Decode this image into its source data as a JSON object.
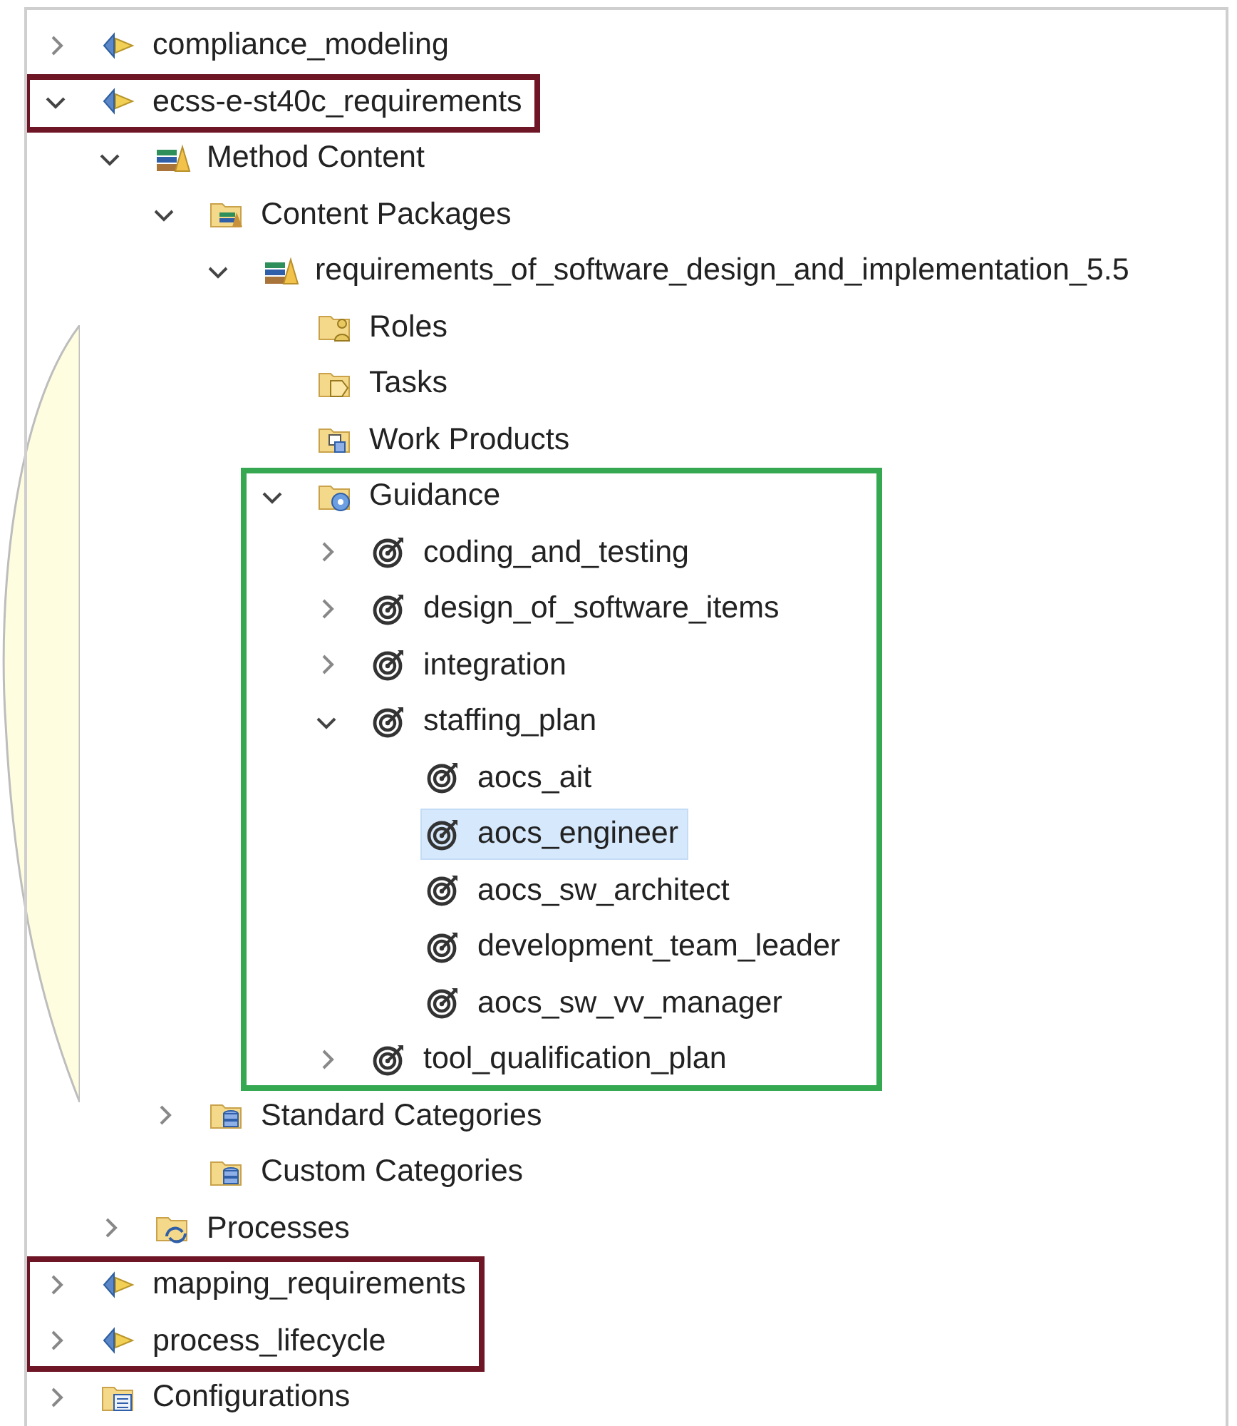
{
  "tree": [
    {
      "label": "compliance_modeling",
      "kind": "plugin",
      "expanded": false,
      "selected": false
    },
    {
      "label": "ecss-e-st40c_requirements",
      "kind": "plugin",
      "expanded": true,
      "selected": false,
      "frame": {
        "color": "#6e1626",
        "subtree": false
      },
      "children": [
        {
          "label": "Method Content",
          "kind": "method-content",
          "expanded": true,
          "selected": false,
          "children": [
            {
              "label": "Content Packages",
              "kind": "package-folder",
              "expanded": true,
              "selected": false,
              "children": [
                {
                  "label": "requirements_of_software_design_and_implementation_5.5",
                  "kind": "package",
                  "expanded": true,
                  "selected": false,
                  "children": [
                    {
                      "label": "Roles",
                      "kind": "roles",
                      "selected": false
                    },
                    {
                      "label": "Tasks",
                      "kind": "tasks",
                      "selected": false
                    },
                    {
                      "label": "Work Products",
                      "kind": "work-products",
                      "selected": false
                    },
                    {
                      "label": "Guidance",
                      "kind": "guidance",
                      "expanded": true,
                      "selected": false,
                      "frame": {
                        "color": "#36a852",
                        "subtree": true
                      },
                      "children": [
                        {
                          "label": "coding_and_testing",
                          "kind": "guideline",
                          "expanded": false,
                          "selected": false
                        },
                        {
                          "label": "design_of_software_items",
                          "kind": "guideline",
                          "expanded": false,
                          "selected": false
                        },
                        {
                          "label": "integration",
                          "kind": "guideline",
                          "expanded": false,
                          "selected": false
                        },
                        {
                          "label": "staffing_plan",
                          "kind": "guideline",
                          "expanded": true,
                          "selected": false,
                          "children": [
                            {
                              "label": "aocs_ait",
                              "kind": "guideline",
                              "selected": false
                            },
                            {
                              "label": "aocs_engineer",
                              "kind": "guideline",
                              "selected": true
                            },
                            {
                              "label": "aocs_sw_architect",
                              "kind": "guideline",
                              "selected": false
                            },
                            {
                              "label": "development_team_leader",
                              "kind": "guideline",
                              "selected": false
                            },
                            {
                              "label": "aocs_sw_vv_manager",
                              "kind": "guideline",
                              "selected": false
                            }
                          ]
                        },
                        {
                          "label": "tool_qualification_plan",
                          "kind": "guideline",
                          "expanded": false,
                          "selected": false
                        }
                      ]
                    }
                  ]
                }
              ]
            },
            {
              "label": "Standard Categories",
              "kind": "categories",
              "expanded": false,
              "selected": false
            },
            {
              "label": "Custom Categories",
              "kind": "categories",
              "selected": false
            }
          ]
        },
        {
          "label": "Processes",
          "kind": "processes",
          "expanded": false,
          "selected": false
        }
      ]
    },
    {
      "label": "mapping_requirements",
      "kind": "plugin",
      "expanded": false,
      "selected": false,
      "frame": {
        "color": "#6e1626",
        "subtree": false
      }
    },
    {
      "label": "process_lifecycle",
      "kind": "plugin",
      "expanded": false,
      "selected": false,
      "frame": {
        "color": "#6e1626",
        "subtree": false
      }
    },
    {
      "label": "Configurations",
      "kind": "configurations",
      "expanded": false,
      "selected": false
    }
  ]
}
